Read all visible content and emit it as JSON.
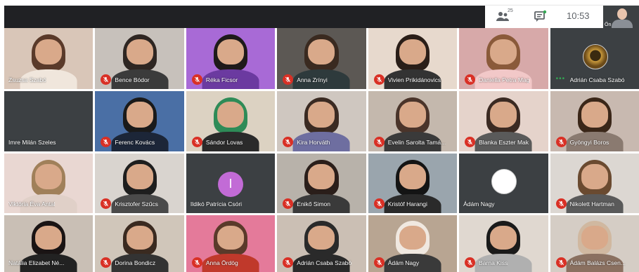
{
  "topbar": {
    "people_count": "25",
    "clock": "10:53",
    "self_label": "Ön"
  },
  "participants": [
    {
      "name": "Zsuzsa Szabó",
      "muted": false,
      "bg": "#d9c6b8",
      "hair": "#5a3a2a",
      "shirt": "#f0e6dc"
    },
    {
      "name": "Bence Bódor",
      "muted": true,
      "bg": "#c7c1bb",
      "hair": "#2e2622",
      "shirt": "#3b3b3b"
    },
    {
      "name": "Réka Ficsor",
      "muted": true,
      "bg": "#a86ad6",
      "hair": "#1e1a1a",
      "shirt": "#6b3aa0"
    },
    {
      "name": "Anna Zrínyi",
      "muted": true,
      "bg": "#5c5854",
      "hair": "#3a2a20",
      "shirt": "#2e3a3c"
    },
    {
      "name": "Vivien Prikidánovics",
      "muted": true,
      "bg": "#e7d9cd",
      "hair": "#2a1e18",
      "shirt": "#333333"
    },
    {
      "name": "Daniella Petra Mag",
      "muted": true,
      "bg": "#d7a9a9",
      "hair": "#8a5a3a",
      "shirt": "#f2c8c8"
    },
    {
      "name": "Adrián Csaba Szabó",
      "muted": false,
      "speaking": true,
      "avatar": "gold"
    },
    {
      "name": "Imre Milán Szeles",
      "muted": false,
      "empty": true
    },
    {
      "name": "Ferenc Kovács",
      "muted": true,
      "bg": "#4a6fa5",
      "hair": "#1a1a1a",
      "shirt": "#1c2638"
    },
    {
      "name": "Sándor Lovas",
      "muted": true,
      "bg": "#dcd2c2",
      "hair": "#2e8b57",
      "shirt": "#2a2a2a"
    },
    {
      "name": "Kira Horváth",
      "muted": true,
      "bg": "#cfc7c0",
      "hair": "#3a2a22",
      "shirt": "#6e6ea0"
    },
    {
      "name": "Evelin Sarolta Tamá...",
      "muted": true,
      "bg": "#c4b8ad",
      "hair": "#4a342a",
      "shirt": "#3a3a3a"
    },
    {
      "name": "Blanka Eszter Mak",
      "muted": true,
      "bg": "#e5d3cb",
      "hair": "#3b2a22",
      "shirt": "#5a5a5a"
    },
    {
      "name": "Gyöngyi Boros",
      "muted": true,
      "bg": "#c8b9b0",
      "hair": "#3a2618",
      "shirt": "#8a7a70"
    },
    {
      "name": "Viktória Éva Antal",
      "muted": false,
      "bg": "#e9d7d2",
      "hair": "#a0805a",
      "shirt": "#e0d0c8"
    },
    {
      "name": "Krisztofer Szűcs",
      "muted": true,
      "bg": "#d9d4cf",
      "hair": "#1e1e1e",
      "shirt": "#4a4a4a"
    },
    {
      "name": "Ildikó Patrícia Csóri",
      "muted": false,
      "empty": true,
      "initial": "I"
    },
    {
      "name": "Enikő Simon",
      "muted": true,
      "bg": "#b8b2aa",
      "hair": "#2a1e1a",
      "shirt": "#3a3a3a"
    },
    {
      "name": "Kristóf Harangi",
      "muted": true,
      "bg": "#9aa5ad",
      "hair": "#141414",
      "shirt": "#2a2a2a"
    },
    {
      "name": "Ádám Nagy",
      "muted": false,
      "empty": true,
      "avatar": "white"
    },
    {
      "name": "Nikolett Hartman",
      "muted": true,
      "bg": "#dcd7d2",
      "hair": "#6a4a30",
      "shirt": "#5a5a5a"
    },
    {
      "name": "Natália Elizabet Né...",
      "muted": false,
      "bg": "#c9bfb5",
      "hair": "#1a1414",
      "shirt": "#222222"
    },
    {
      "name": "Dorina Bondicz",
      "muted": true,
      "bg": "#d0c6ba",
      "hair": "#3a2a20",
      "shirt": "#333333"
    },
    {
      "name": "Anna Ördög",
      "muted": true,
      "bg": "#e47a9a",
      "hair": "#5a3a2a",
      "shirt": "#c0392b"
    },
    {
      "name": "Adrián Csaba Szabó",
      "muted": true,
      "bg": "#cbbfb4",
      "hair": "#2a2a2a",
      "shirt": "#2a2a2a"
    },
    {
      "name": "Ádám Nagy",
      "muted": true,
      "bg": "#b8a592",
      "hair": "#f0e8e0",
      "shirt": "#3a3a3a"
    },
    {
      "name": "Barna Kiss",
      "muted": true,
      "bg": "#e0d8d0",
      "hair": "#1a1a1a",
      "shirt": "#b0b0b0"
    },
    {
      "name": "Ádám Balázs Csen...",
      "muted": true,
      "bg": "#d5cdc5",
      "hair": "#d0b8a0",
      "shirt": "#8a7060"
    }
  ],
  "colors": {
    "muted_badge": "#d93025",
    "speaking_dots": "#34a853",
    "tile_dark": "#3c4043"
  },
  "icons": {
    "people": "people-icon",
    "chat": "chat-icon",
    "mic_off": "mic-off-icon"
  }
}
